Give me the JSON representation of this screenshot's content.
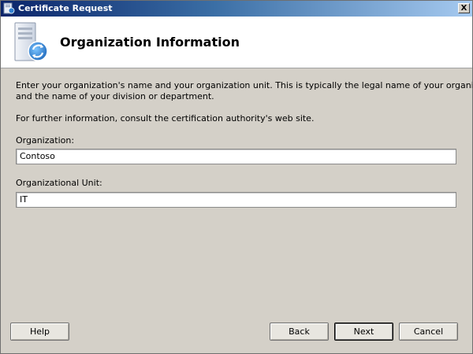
{
  "window": {
    "title": "Certificate Request",
    "close_label": "X"
  },
  "header": {
    "title": "Organization Information",
    "icon": "certificate-server-icon"
  },
  "body": {
    "description": [
      "Enter your organization's name and your organization unit. This is typically the legal name of your organization",
      "and the name of your division or department."
    ],
    "info": "For further information, consult the certification authority's web site."
  },
  "fields": {
    "organization": {
      "label": "Organization:",
      "value": "Contoso"
    },
    "unit": {
      "label": "Organizational Unit:",
      "value": "IT"
    }
  },
  "buttons": {
    "help": "Help",
    "back": "Back",
    "next": "Next",
    "cancel": "Cancel"
  }
}
